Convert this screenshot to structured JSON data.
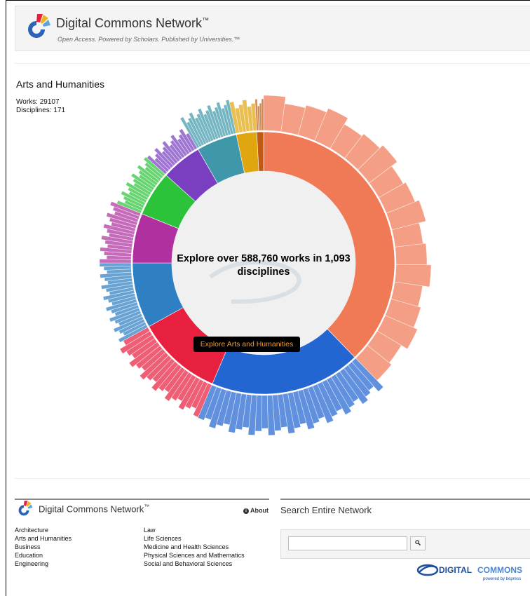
{
  "header": {
    "title": "Digital Commons Network",
    "tm": "™",
    "tagline": "Open Access. Powered by Scholars. Published by Universities.™"
  },
  "discipline": {
    "title": "Arts and Humanities",
    "works": "Works: 29107",
    "disciplines": "Disciplines: 171"
  },
  "sunburst": {
    "center_text": "Explore over 588,760 works in 1,093 disciplines",
    "explore_button": "Explore Arts and Humanities",
    "colors": {
      "orange": "#f07a55",
      "blue": "#2366d1",
      "red": "#e8203f",
      "steel": "#2f7fc3",
      "magenta": "#b0309f",
      "green": "#2cc33a",
      "purple": "#7a3fc0",
      "teal": "#3e98aa",
      "gold": "#e0a60f",
      "brown": "#c05a12"
    }
  },
  "footer": {
    "brand": "Digital Commons Network",
    "tm": "™",
    "about": "About",
    "col1": [
      "Architecture",
      "Arts and Humanities",
      "Business",
      "Education",
      "Engineering"
    ],
    "col2": [
      "Law",
      "Life Sciences",
      "Medicine and Health Sciences",
      "Physical Sciences and Mathematics",
      "Social and Behavioral Sciences"
    ]
  },
  "search": {
    "title": "Search Entire Network",
    "placeholder": "",
    "button_icon": "search-icon"
  },
  "bepress": {
    "brand_dark": "DIGITAL",
    "brand_light": "COMMONS",
    "subtitle": "powered by bepress"
  }
}
